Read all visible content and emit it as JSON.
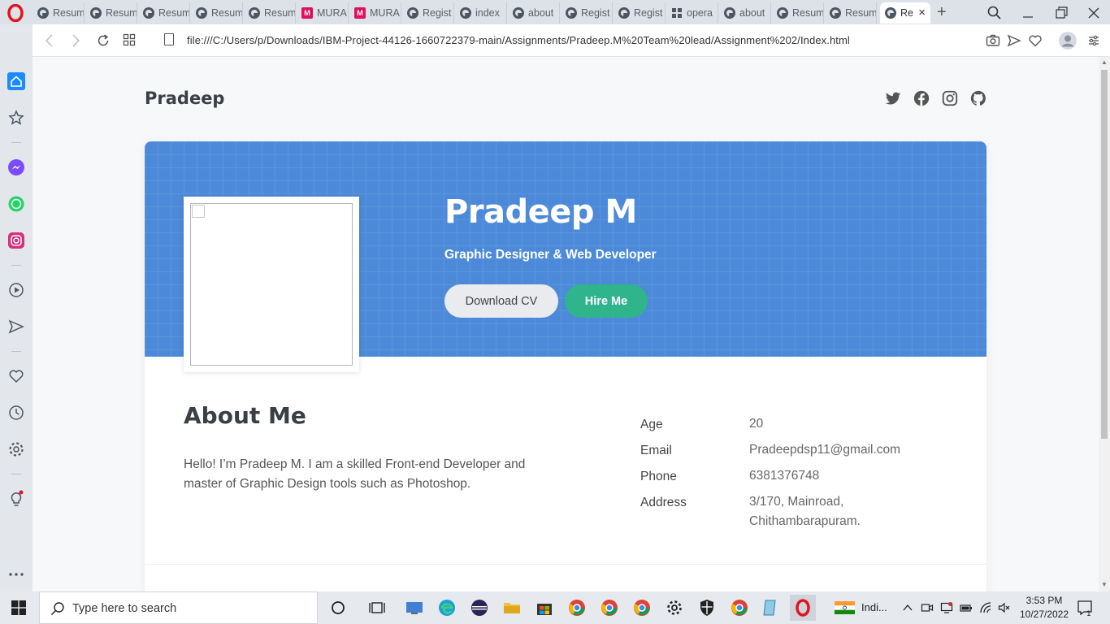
{
  "browser": {
    "tabs": [
      {
        "label": "Resum",
        "icon": "globe-icon"
      },
      {
        "label": "Resum",
        "icon": "globe-icon"
      },
      {
        "label": "Resum",
        "icon": "globe-icon"
      },
      {
        "label": "Resum",
        "icon": "globe-icon"
      },
      {
        "label": "Resum",
        "icon": "globe-icon"
      },
      {
        "label": "MURA",
        "icon": "m-icon"
      },
      {
        "label": "MURA",
        "icon": "m-icon"
      },
      {
        "label": "Regist",
        "icon": "globe-icon"
      },
      {
        "label": "index",
        "icon": "globe-icon"
      },
      {
        "label": "about",
        "icon": "globe-icon"
      },
      {
        "label": "Regist",
        "icon": "globe-icon"
      },
      {
        "label": "Regist",
        "icon": "globe-icon"
      },
      {
        "label": "opera",
        "icon": "grid-icon"
      },
      {
        "label": "about",
        "icon": "globe-icon"
      },
      {
        "label": "Resum",
        "icon": "globe-icon"
      },
      {
        "label": "Resum",
        "icon": "globe-icon"
      },
      {
        "label": "Re",
        "icon": "globe-icon",
        "active": true
      }
    ],
    "url": "file:///C:/Users/p/Downloads/IBM-Project-44126-1660722379-main/Assignments/Pradeep.M%20Team%20lead/Assignment%202/Index.html"
  },
  "site": {
    "brand": "Pradeep",
    "social_icons": [
      "twitter-icon",
      "facebook-icon",
      "instagram-icon",
      "github-icon"
    ],
    "hero": {
      "name": "Pradeep M",
      "role": "Graphic Designer & Web Developer",
      "download_cv": "Download CV",
      "hire_me": "Hire Me"
    },
    "about": {
      "title": "About Me",
      "text": "Hello! I’m Pradeep M. I am a skilled Front-end Developer and master of Graphic Design tools such as Photoshop."
    },
    "info": [
      {
        "label": "Age",
        "value": "20"
      },
      {
        "label": "Email",
        "value": "Pradeepdsp11@gmail.com"
      },
      {
        "label": "Phone",
        "value": "6381376748"
      },
      {
        "label": "Address",
        "value": "3/170, Mainroad, Chithambarapuram."
      }
    ]
  },
  "taskbar": {
    "search_placeholder": "Type here to search",
    "language": "Indi...",
    "time": "3:53 PM",
    "date": "10/27/2022"
  },
  "colors": {
    "hero_blue": "#4c8ad9",
    "hire_green": "#2fb48c",
    "opera_red": "#e0141e"
  }
}
